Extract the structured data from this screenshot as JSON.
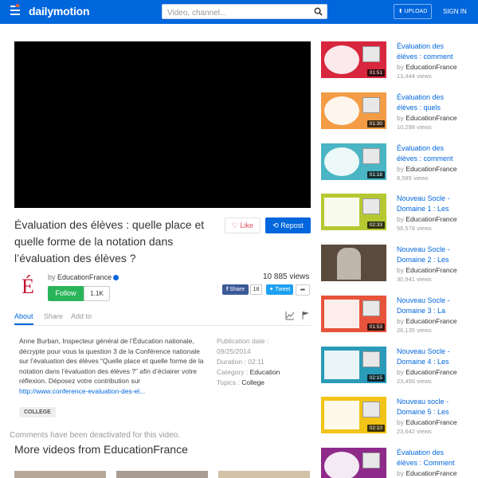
{
  "header": {
    "logo": "dailymotion",
    "search_placeholder": "Video, channel...",
    "upload_label": "UPLOAD",
    "signin_label": "SIGN IN"
  },
  "video": {
    "title": "Évaluation des élèves : quelle place et quelle forme de la notation dans l’évaluation des élèves ?",
    "like_label": "Like",
    "repost_label": "Repost",
    "by_label": "by",
    "channel": "EducationFrance",
    "views": "10 885 views",
    "follow_label": "Follow",
    "follow_count": "1.1K",
    "fb_share_label": "Share",
    "fb_share_count": "18",
    "tweet_label": "Tweet"
  },
  "tabs": [
    "About",
    "Share",
    "Add to"
  ],
  "description": {
    "text": "Anne Burban, Inspecteur général de l’Éducation nationale, décrypte pour vous la question 3 de la Conférence nationale sur l’évaluation des élèves “Quelle place et quelle forme de la notation dans l’évaluation des élèves ?” afin d’éclairer votre réflexion. Déposez votre contribution sur ",
    "link": "http://www.conference-evaluation-des-el..."
  },
  "meta": {
    "pub_label": "Publication date :",
    "pub_value": "09/25/2014",
    "dur_label": "Duration :",
    "dur_value": "02:11",
    "cat_label": "Category :",
    "cat_value": "Education",
    "topics_label": "Topics :",
    "topics_value": "College"
  },
  "tag": "COLLEGE",
  "comments_off": "Comments have been deactivated for this video.",
  "more_title": "More videos from EducationFrance",
  "sidebar": {
    "by_label": "by",
    "items": [
      {
        "title1": "Évaluation des",
        "title2": "élèves : comment",
        "channel": "EducationFrance",
        "views": "13,444 views",
        "duration": "01:51",
        "color": "#d7263d"
      },
      {
        "title1": "Évaluation des",
        "title2": "élèves : quels",
        "channel": "EducationFrance",
        "views": "10,298 views",
        "duration": "01:30",
        "color": "#f39c45"
      },
      {
        "title1": "Évaluation des",
        "title2": "élèves : comment",
        "channel": "EducationFrance",
        "views": "8,585 views",
        "duration": "01:18",
        "color": "#4ab5c4"
      },
      {
        "title1": "Nouveau Socle -",
        "title2": "Domaine 1 : Les",
        "channel": "EducationFrance",
        "views": "56,578 views",
        "duration": "02:33",
        "color": "#b5c832"
      },
      {
        "title1": "Nouveau Socle -",
        "title2": "Domaine 2 : Les",
        "channel": "EducationFrance",
        "views": "30,941 views",
        "duration": "",
        "color": "#5a4a3e"
      },
      {
        "title1": "Nouveau Socle -",
        "title2": "Domaine 3 : La",
        "channel": "EducationFrance",
        "views": "26,135 views",
        "duration": "01:53",
        "color": "#e8533b"
      },
      {
        "title1": "Nouveau Socle -",
        "title2": "Domaine 4 : Les",
        "channel": "EducationFrance",
        "views": "23,450 views",
        "duration": "02:15",
        "color": "#2a9bb8"
      },
      {
        "title1": "Nouveau socle -",
        "title2": "Domaine 5 : Les",
        "channel": "EducationFrance",
        "views": "23,642 views",
        "duration": "02:10",
        "color": "#f2c417"
      },
      {
        "title1": "Évaluation des",
        "title2": "élèves : Comment",
        "channel": "EducationFrance",
        "views": "",
        "duration": "",
        "color": "#8e2a8a"
      }
    ]
  }
}
